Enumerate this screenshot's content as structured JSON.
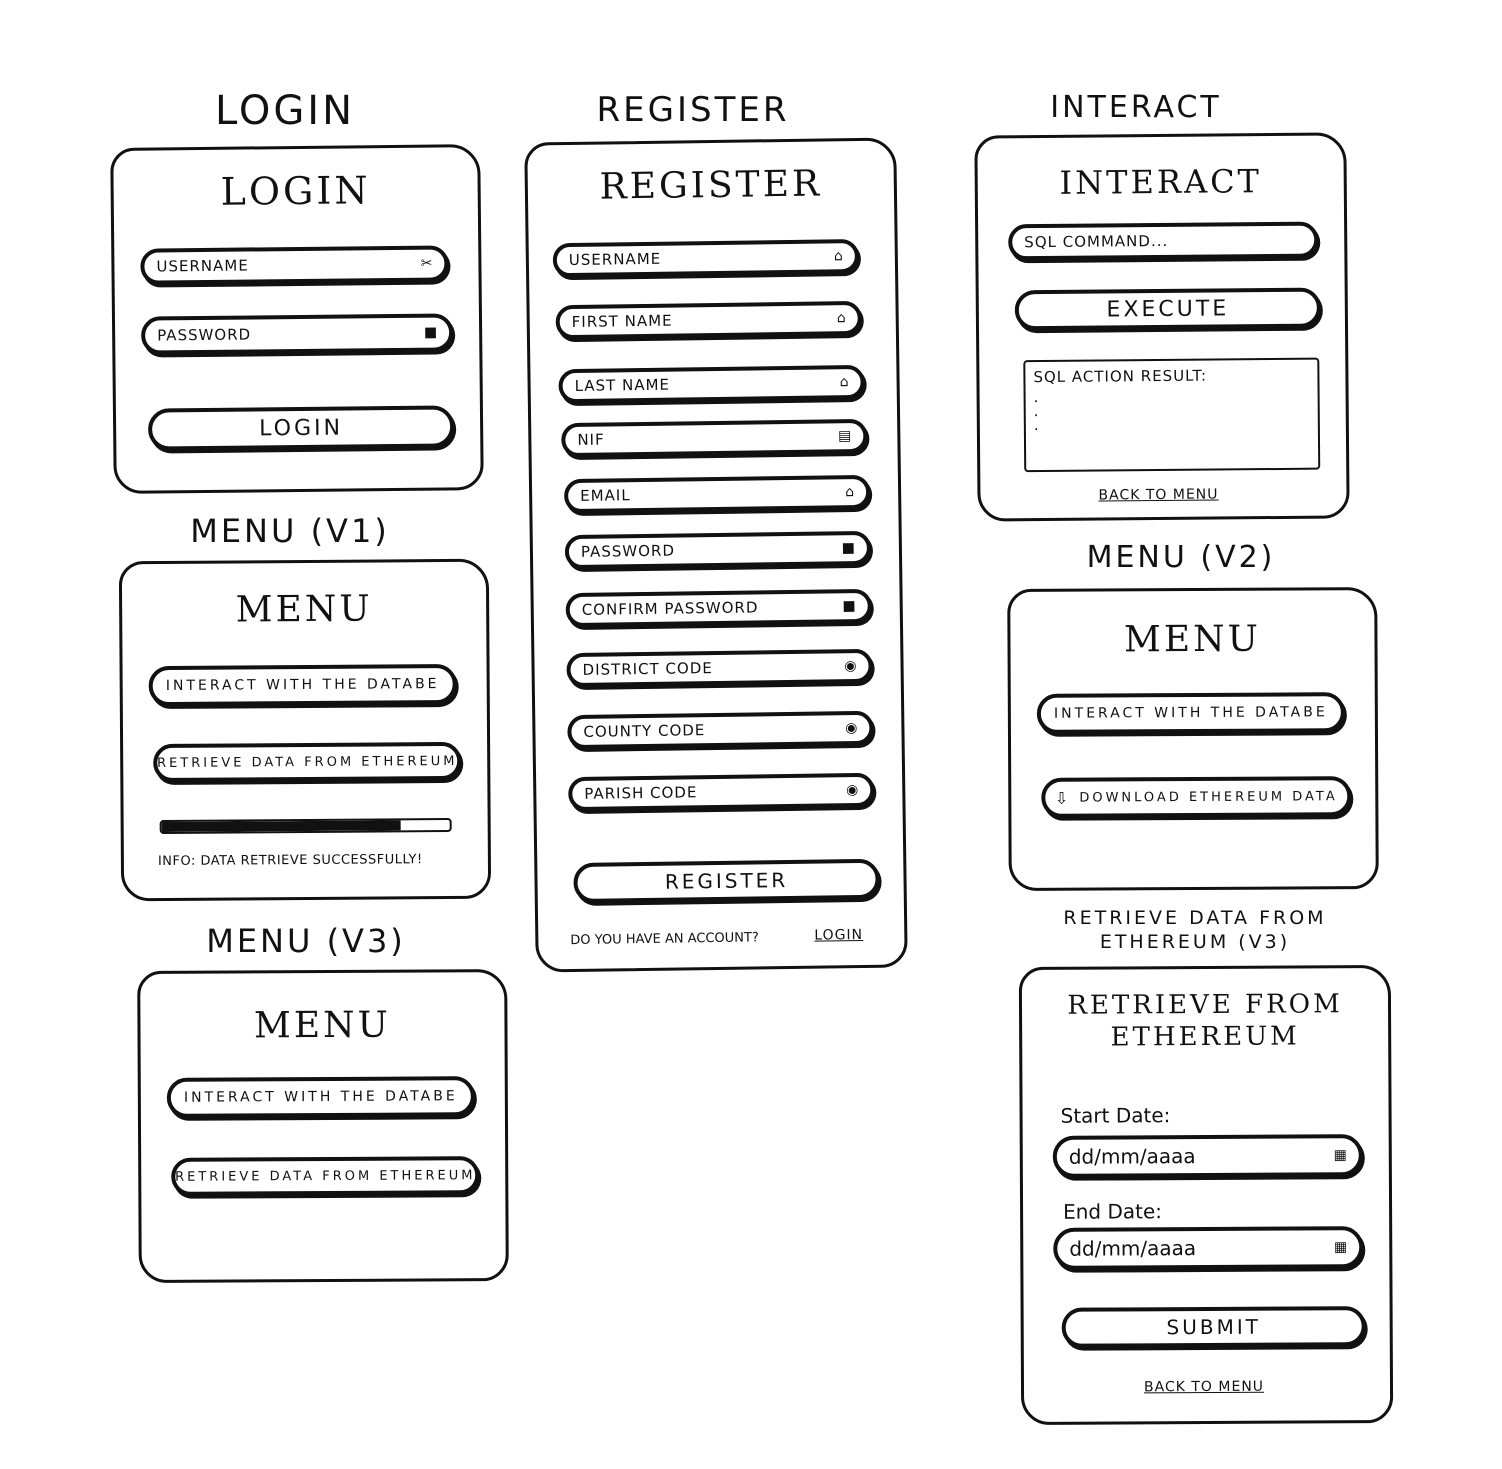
{
  "login": {
    "caption": "LOGIN",
    "title": "LOGIN",
    "username_placeholder": "USERNAME",
    "password_placeholder": "PASSWORD",
    "login_button": "LOGIN",
    "icons": {
      "username": "user-icon",
      "password": "lock-icon"
    }
  },
  "register": {
    "caption": "REGISTER",
    "title": "REGISTER",
    "fields": [
      {
        "label": "USERNAME",
        "icon": "user-icon"
      },
      {
        "label": "FIRST NAME",
        "icon": "user-icon"
      },
      {
        "label": "LAST NAME",
        "icon": "user-icon"
      },
      {
        "label": "NIF",
        "icon": "id-card-icon"
      },
      {
        "label": "EMAIL",
        "icon": "user-icon"
      },
      {
        "label": "PASSWORD",
        "icon": "lock-icon"
      },
      {
        "label": "CONFIRM PASSWORD",
        "icon": "lock-icon"
      },
      {
        "label": "DISTRICT CODE",
        "icon": "map-pin-icon"
      },
      {
        "label": "COUNTY CODE",
        "icon": "map-pin-icon"
      },
      {
        "label": "PARISH CODE",
        "icon": "map-pin-icon"
      }
    ],
    "register_button": "REGISTER",
    "account_prompt": "DO YOU HAVE AN ACCOUNT?",
    "login_link": "LOGIN"
  },
  "interact": {
    "caption": "INTERACT",
    "title": "INTERACT",
    "sql_placeholder": "SQL COMMAND...",
    "execute_button": "EXECUTE",
    "result_label": "SQL ACTION RESULT:",
    "result_lines": ".\n.\n.",
    "back_link": "BACK TO MENU"
  },
  "menu_v1": {
    "caption": "MENU (V1)",
    "title": "MENU",
    "interact_button": "INTERACT WITH THE DATABE",
    "retrieve_button": "RETRIEVE DATA FROM ETHEREUM",
    "progress_fraction": 0.83,
    "info_text": "INFO: DATA RETRIEVE SUCCESSFULLY!"
  },
  "menu_v2": {
    "caption": "MENU (V2)",
    "title": "MENU",
    "interact_button": "INTERACT WITH THE DATABE",
    "download_button": "DOWNLOAD ETHEREUM DATA",
    "download_icon": "download-icon"
  },
  "menu_v3": {
    "caption": "MENU (V3)",
    "title": "MENU",
    "interact_button": "INTERACT WITH THE DATABE",
    "retrieve_button": "RETRIEVE DATA FROM ETHEREUM"
  },
  "retrieve_v3": {
    "caption_line1": "RETRIEVE DATA FROM",
    "caption_line2": "ETHEREUM (V3)",
    "title_line1": "RETRIEVE FROM",
    "title_line2": "ETHEREUM",
    "start_label": "Start Date:",
    "start_placeholder": "dd/mm/aaaa",
    "end_label": "End Date:",
    "end_placeholder": "dd/mm/aaaa",
    "submit_button": "SUBMIT",
    "back_link": "BACK TO MENU",
    "calendar_icon": "calendar-icon"
  }
}
